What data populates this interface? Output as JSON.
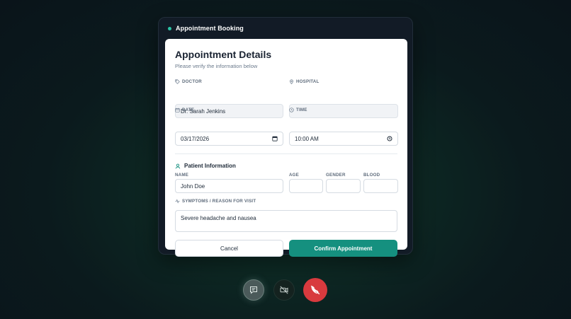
{
  "panel": {
    "title": "Appointment Booking"
  },
  "card": {
    "title": "Appointment Details",
    "subtitle": "Please verify the information below"
  },
  "fields": {
    "doctor": {
      "label": "DOCTOR",
      "value": "Dr. Sarah Jenkins"
    },
    "hospital": {
      "label": "HOSPITAL",
      "value": ""
    },
    "date": {
      "label": "DATE",
      "value": "03/17/2026"
    },
    "time": {
      "label": "TIME",
      "value": "10:00 AM"
    }
  },
  "patient": {
    "section_title": "Patient Information",
    "name": {
      "label": "NAME",
      "value": "John Doe"
    },
    "age": {
      "label": "AGE",
      "value": ""
    },
    "gender": {
      "label": "GENDER",
      "value": ""
    },
    "blood": {
      "label": "BLOOD",
      "value": ""
    },
    "symptoms": {
      "label": "SYMPTOMS / REASON FOR VISIT",
      "value": "Severe headache and nausea"
    }
  },
  "actions": {
    "cancel_label": "Cancel",
    "confirm_label": "Confirm Appointment"
  },
  "call_controls": {
    "chat_icon": "chat-icon",
    "video_icon": "video-off-icon",
    "end_icon": "phone-end-icon"
  },
  "colors": {
    "accent": "#15907f",
    "end_call": "#d83a3e",
    "status_dot": "#2bc4a6"
  }
}
